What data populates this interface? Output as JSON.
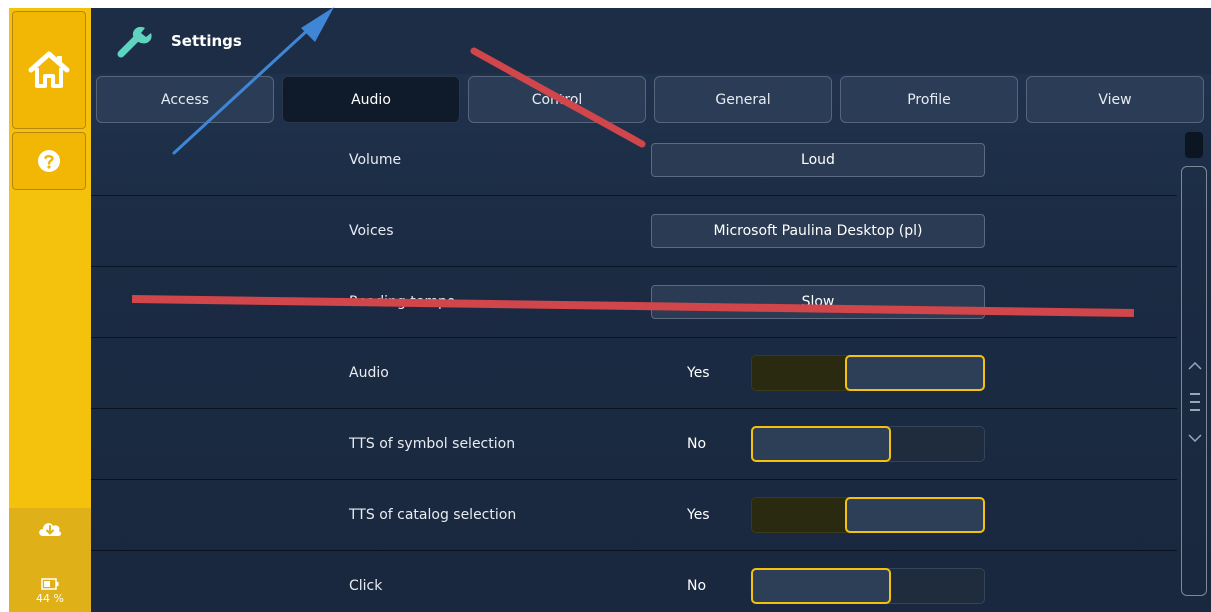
{
  "header": {
    "title": "Settings"
  },
  "tabs": [
    {
      "label": "Access",
      "active": false
    },
    {
      "label": "Audio",
      "active": true
    },
    {
      "label": "Control",
      "active": false
    },
    {
      "label": "General",
      "active": false
    },
    {
      "label": "Profile",
      "active": false
    },
    {
      "label": "View",
      "active": false
    }
  ],
  "rows": [
    {
      "label": "Volume",
      "type": "select",
      "value": "Loud"
    },
    {
      "label": "Voices",
      "type": "select",
      "value": "Microsoft Paulina Desktop (pl)"
    },
    {
      "label": "Reading tempo",
      "type": "select",
      "value": "Slow"
    },
    {
      "label": "Audio",
      "type": "toggle",
      "value": "Yes"
    },
    {
      "label": "TTS of symbol selection",
      "type": "toggle",
      "value": "No"
    },
    {
      "label": "TTS of catalog selection",
      "type": "toggle",
      "value": "Yes"
    },
    {
      "label": "Click",
      "type": "toggle",
      "value": "No"
    }
  ],
  "sidebar": {
    "home_icon": "home-icon",
    "help_icon": "help-icon",
    "cloud_icon": "cloud-download-icon",
    "battery_icon": "battery-icon",
    "battery_percent": "44 %"
  },
  "colors": {
    "accent": "#f4c20d",
    "background": "#1c2c42",
    "annotation_red": "#d0464a",
    "annotation_blue": "#3f86d6"
  }
}
